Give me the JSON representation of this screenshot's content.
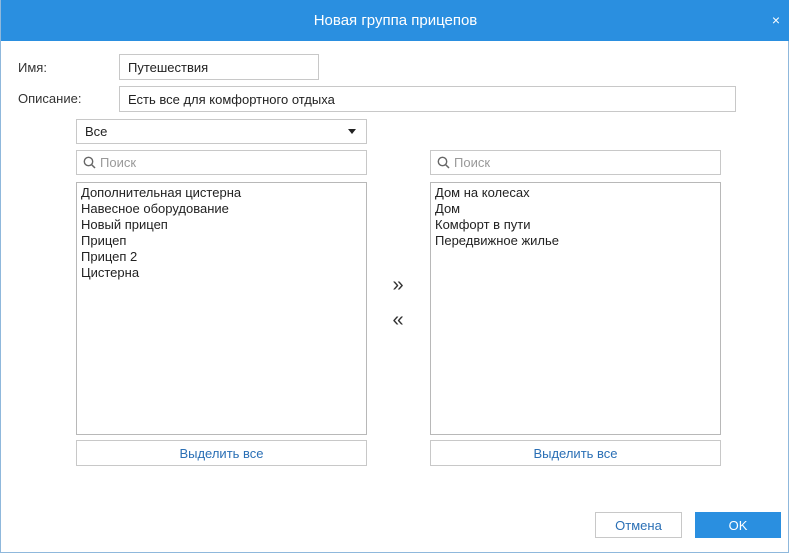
{
  "dialog": {
    "title": "Новая группа прицепов",
    "close_glyph": "×"
  },
  "form": {
    "name_label": "Имя:",
    "name_value": "Путешествия",
    "description_label": "Описание:",
    "description_value": "Есть все для комфортного отдыха"
  },
  "filter": {
    "selected": "Все"
  },
  "left_list": {
    "search_placeholder": "Поиск",
    "items": [
      "Дополнительная цистерна",
      "Навесное оборудование",
      "Новый прицеп",
      "Прицеп",
      "Прицеп 2",
      "Цистерна"
    ],
    "select_all_label": "Выделить все"
  },
  "right_list": {
    "search_placeholder": "Поиск",
    "items": [
      "Дом на колесах",
      "Дом",
      "Комфорт в пути",
      "Передвижное жилье"
    ],
    "select_all_label": "Выделить все"
  },
  "transfer": {
    "move_right": "»",
    "move_left": "«"
  },
  "footer": {
    "cancel_label": "Отмена",
    "ok_label": "OK"
  },
  "colors": {
    "accent": "#2a8fe0",
    "link": "#2a6fb5"
  }
}
